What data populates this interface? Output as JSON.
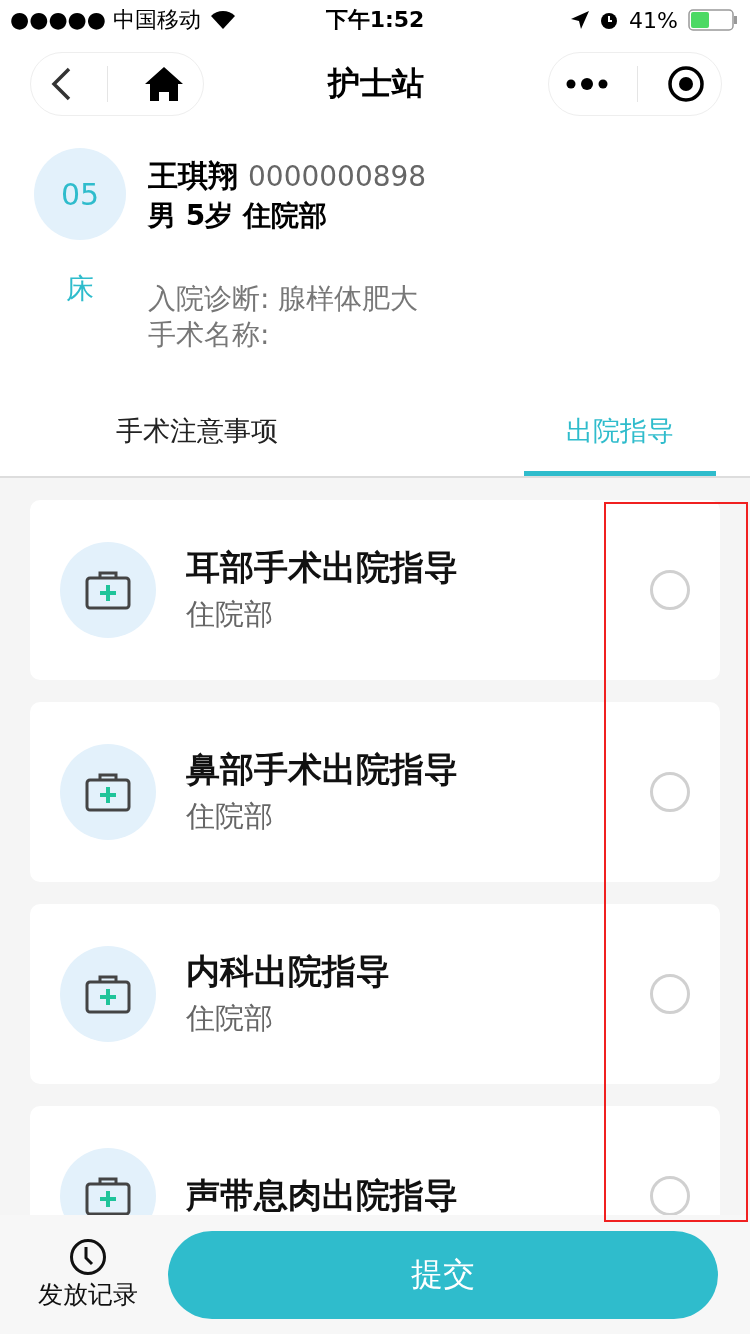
{
  "status_bar": {
    "carrier": "●●●●● 中国移动",
    "time": "下午1:52",
    "battery": "41%"
  },
  "nav": {
    "title": "护士站"
  },
  "patient": {
    "bed_number": "05",
    "bed_label": "床",
    "name": "王琪翔",
    "id": "0000000898",
    "details": "男 5岁 住院部",
    "diagnosis": "入院诊断: 腺样体肥大",
    "surgery": "手术名称:"
  },
  "tabs": [
    {
      "label": "手术注意事项",
      "selected": false
    },
    {
      "label": "出院指导",
      "selected": true
    }
  ],
  "items": [
    {
      "title": "耳部手术出院指导",
      "subtitle": "住院部",
      "selected": false
    },
    {
      "title": "鼻部手术出院指导",
      "subtitle": "住院部",
      "selected": false
    },
    {
      "title": "内科出院指导",
      "subtitle": "住院部",
      "selected": false
    },
    {
      "title": "声带息肉出院指导",
      "selected": false
    }
  ],
  "bottom": {
    "history_label": "发放记录",
    "submit_label": "提交"
  }
}
